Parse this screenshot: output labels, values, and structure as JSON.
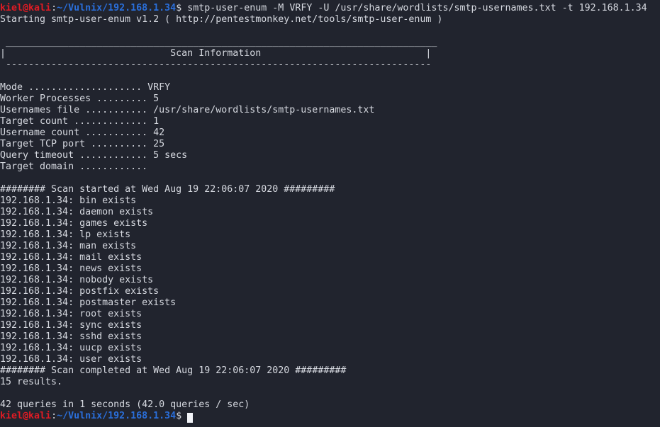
{
  "terminal": {
    "background": "#21242e",
    "foreground": "#d6d9e0",
    "prompt_user_color": "#e01b24",
    "prompt_path_color": "#2a6fdb",
    "cursor_color": "#f2f4f8"
  },
  "prompt": {
    "user_host": "kiel@kali",
    "separator": ":",
    "path": "~/Vulnix/192.168.1.34",
    "sigil": "$"
  },
  "command": {
    "text": " smtp-user-enum -M VRFY -U /usr/share/wordlists/smtp-usernames.txt -t 192.168.1.34"
  },
  "banner": {
    "starting_line": "Starting smtp-user-enum v1.2 ( http://pentestmonkey.net/tools/smtp-user-enum )",
    "box_top": " ____________________________________________________________________________",
    "box_title": "|                             Scan Information                             |",
    "box_bottom": " ---------------------------------------------------------------------------"
  },
  "scan_info": {
    "rows": [
      {
        "label": "Mode",
        "leader": " .................... ",
        "value": "VRFY"
      },
      {
        "label": "Worker Processes",
        "leader": " ......... ",
        "value": "5"
      },
      {
        "label": "Usernames file",
        "leader": " ........... ",
        "value": "/usr/share/wordlists/smtp-usernames.txt"
      },
      {
        "label": "Target count",
        "leader": " ............. ",
        "value": "1"
      },
      {
        "label": "Username count",
        "leader": " ........... ",
        "value": "42"
      },
      {
        "label": "Target TCP port",
        "leader": " .......... ",
        "value": "25"
      },
      {
        "label": "Query timeout",
        "leader": " ............ ",
        "value": "5 secs"
      },
      {
        "label": "Target domain",
        "leader": " ............",
        "value": ""
      }
    ]
  },
  "scan_start": {
    "prefix": "########",
    "text": " Scan started at Wed Aug 19 22:06:07 2020 ",
    "suffix": "#########"
  },
  "results": {
    "host": "192.168.1.34",
    "users": [
      "bin",
      "daemon",
      "games",
      "lp",
      "man",
      "mail",
      "news",
      "nobody",
      "postfix",
      "postmaster",
      "root",
      "sync",
      "sshd",
      "uucp",
      "user"
    ],
    "status": "exists"
  },
  "scan_end": {
    "prefix": "########",
    "text": " Scan completed at Wed Aug 19 22:06:07 2020 ",
    "suffix": "#########"
  },
  "summary": {
    "results_line": "15 results.",
    "queries_line": "42 queries in 1 seconds (42.0 queries / sec)"
  }
}
